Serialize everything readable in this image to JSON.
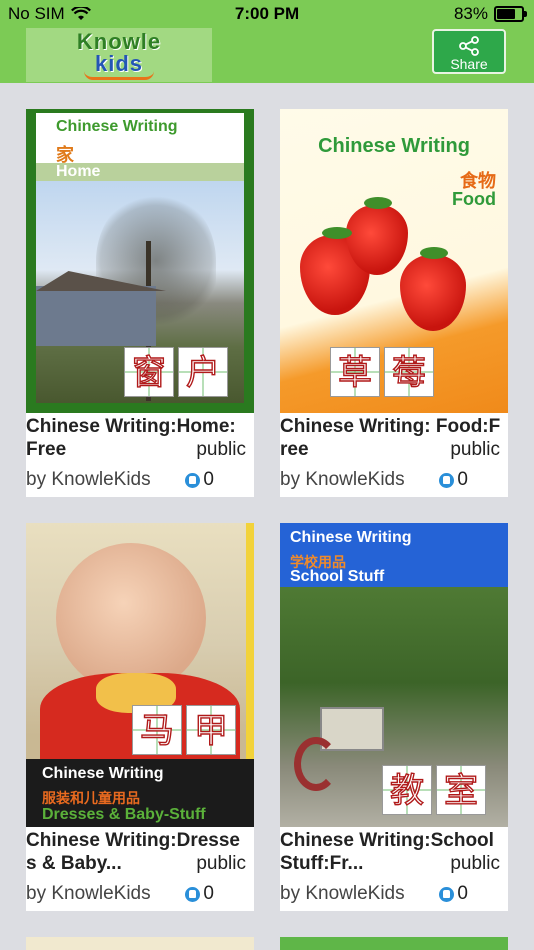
{
  "status": {
    "carrier": "No SIM",
    "time": "7:00 PM",
    "battery": "83%"
  },
  "header": {
    "logo_line1": "Knowle",
    "logo_line2": "kids",
    "share_label": "Share"
  },
  "cards": [
    {
      "cover_heading": "Chinese Writing",
      "cover_cn": "家",
      "cover_en": "Home",
      "chars": [
        "窗",
        "户"
      ],
      "title": "Chinese Writing:Home: Free",
      "visibility": "public",
      "author": "by KnowleKids",
      "likes": "0"
    },
    {
      "cover_heading": "Chinese Writing",
      "cover_cn": "食物",
      "cover_en": "Food",
      "chars": [
        "草",
        "莓"
      ],
      "title": "Chinese Writing: Food:F ree",
      "visibility": "public",
      "author": "by KnowleKids",
      "likes": "0"
    },
    {
      "cover_heading": "Chinese Writing",
      "cover_cn": "服装和儿童用品",
      "cover_en": "Dresses & Baby-Stuff",
      "chars": [
        "马",
        "甲"
      ],
      "title": "Chinese Writing:Dresse s & Baby...",
      "visibility": "public",
      "author": "by KnowleKids",
      "likes": "0"
    },
    {
      "cover_heading": "Chinese Writing",
      "cover_cn": "学校用品",
      "cover_en": "School Stuff",
      "chars": [
        "教",
        "室"
      ],
      "title": "Chinese Writing:School Stuff:Fr...",
      "visibility": "public",
      "author": "by KnowleKids",
      "likes": "0"
    }
  ]
}
